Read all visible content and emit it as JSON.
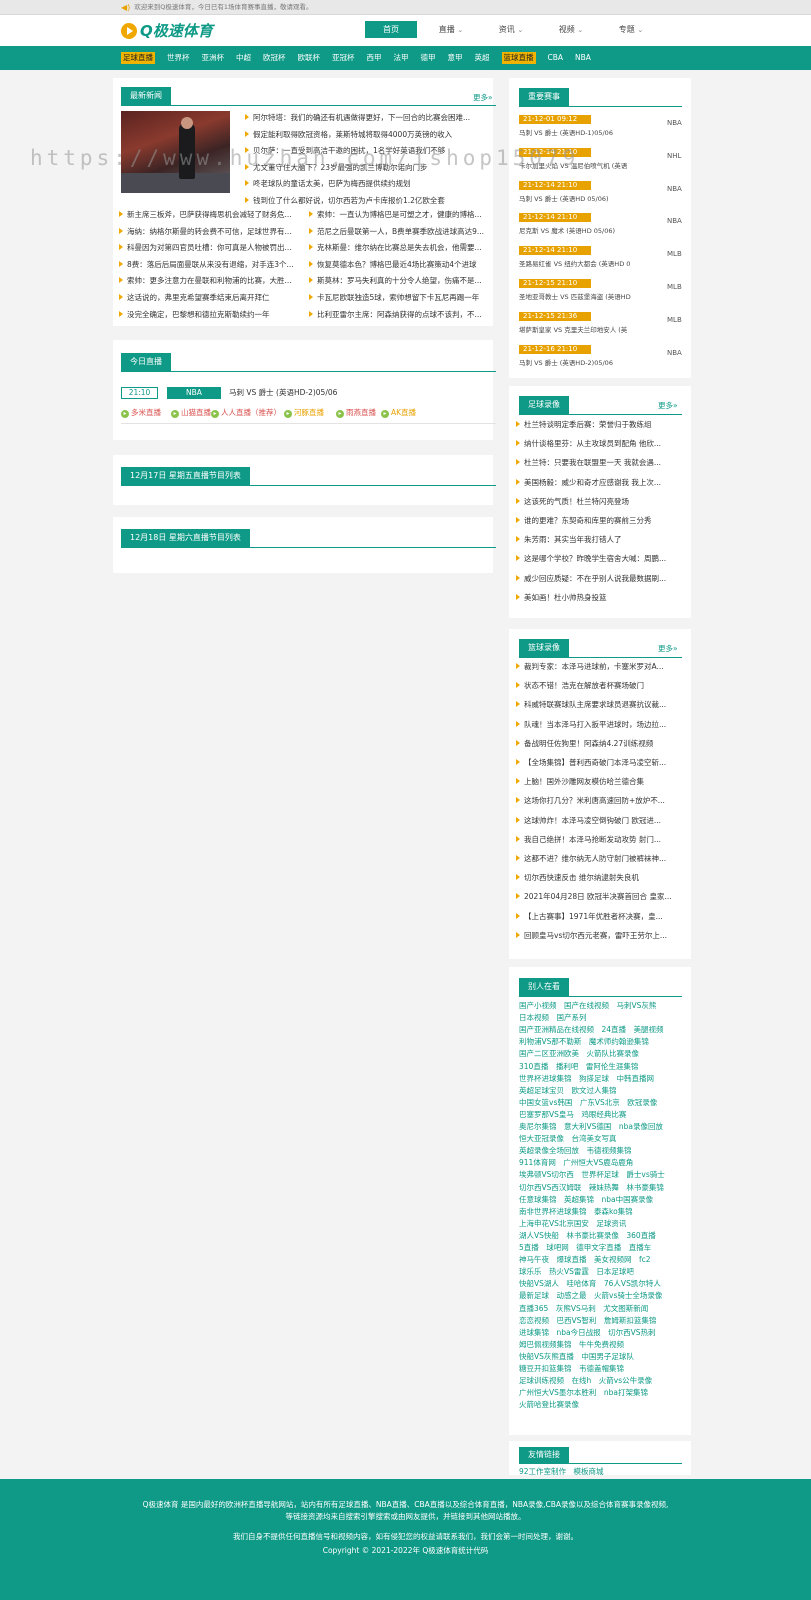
{
  "topbar": {
    "text": "欢迎来到Q极速体育，今日已有1场体育赛事直播，敬请观看。"
  },
  "logo": {
    "text": "Q极速体育"
  },
  "nav": {
    "items": [
      {
        "label": "首页",
        "active": true,
        "caret": ""
      },
      {
        "label": "直播",
        "active": false,
        "caret": "⌄"
      },
      {
        "label": "资讯",
        "active": false,
        "caret": "⌄"
      },
      {
        "label": "视频",
        "active": false,
        "caret": "⌄"
      },
      {
        "label": "专题",
        "active": false,
        "caret": "⌄"
      }
    ]
  },
  "categories": [
    {
      "label": "足球直播",
      "hl": true
    },
    {
      "label": "世界杯",
      "hl": false
    },
    {
      "label": "亚洲杯",
      "hl": false
    },
    {
      "label": "中超",
      "hl": false
    },
    {
      "label": "欧冠杯",
      "hl": false
    },
    {
      "label": "欧联杯",
      "hl": false
    },
    {
      "label": "亚冠杯",
      "hl": false
    },
    {
      "label": "西甲",
      "hl": false
    },
    {
      "label": "法甲",
      "hl": false
    },
    {
      "label": "德甲",
      "hl": false
    },
    {
      "label": "意甲",
      "hl": false
    },
    {
      "label": "英超",
      "hl": false
    },
    {
      "label": "篮球直播",
      "hl": true
    },
    {
      "label": "CBA",
      "hl": false
    },
    {
      "label": "NBA",
      "hl": false
    }
  ],
  "news": {
    "title": "最新新闻",
    "more": "更多»",
    "featured": [
      "阿尔特塔：我们的确还有机遇做得更好，下一回合的比赛会困难...",
      "假定能利取得欧冠资格，莱斯特城将取得4000万英镑的收入",
      "贝尔萨：一直受到高洁干邀的困扰，1名学好英语我们不够",
      "尤文董守住大脑下？23岁最强的凯兰博勒尔诺向门步",
      "咚老球队的童话太美，巴萨为梅西提供续约规划",
      "钱到位了什么都好说，切尔西若为卢卡库报价1.2亿欧全套"
    ],
    "left": [
      "新主席三板斧，巴萨获得梅思机会减轻了财务危...",
      "海纳：纳格尔斯曼的转会费不可信，足球世界有...",
      "科曼因为对第四官员吐槽：你可真是人物被罚出...",
      "8费：落后后局面曼联从来没有退缩，对手连3个...",
      "索帅：更多注意力在曼联和利物浦的比赛，大胜...",
      "这话说的，弗里克希望赛季结束后离开拜仁",
      "没完全确定，巴黎想和德拉克斯勒续约一年"
    ],
    "right": [
      "索帅：一直认为博格巴是可塑之才，健康的博格...",
      "范尼之后曼联第一人，B费单赛季欧战进球高达9...",
      "克林斯曼：维尔纳在比赛总是失去机会，他需要...",
      "恢复莫德本色？博格巴最近4场比赛策动4个进球",
      "斯莫林：罗马失利真的十分令人绝望，伤痛不是...",
      "卡瓦尼欧联独造5球，索帅想留下卡瓦尼再踢一年",
      "比利亚雷尔主席：阿森纳获得的点球不该判，不..."
    ]
  },
  "today": {
    "title": "今日直播",
    "time": "21:10",
    "category": "NBA",
    "match": "马刺 VS 爵士 (英语HD-2)05/06",
    "channels": [
      {
        "label": "多米直播",
        "color": "#d9534f"
      },
      {
        "label": "山猫直播",
        "color": "#d9534f"
      },
      {
        "label": "人人直播（推荐）",
        "color": "#d9534f"
      },
      {
        "label": "河豚直播",
        "color": "#e8a200"
      },
      {
        "label": "雨燕直播",
        "color": "#d9534f"
      },
      {
        "label": "AK直播",
        "color": "#e8a200"
      }
    ]
  },
  "schedule": {
    "day1": "12月17日 星期五直播节目列表",
    "day2": "12月18日 星期六直播节目列表"
  },
  "important": {
    "title": "重要赛事",
    "items": [
      {
        "time": "21-12-01 09:12",
        "name": "马刺 VS 爵士 (英语HD-1)05/06",
        "league": "NBA"
      },
      {
        "time": "21-12-14 21:10",
        "name": "卡尔加里火焰 VS 温尼伯喷气机 (英语",
        "league": "NHL"
      },
      {
        "time": "21-12-14 21:10",
        "name": "马刺 VS 爵士 (英语HD 05/06)",
        "league": "NBA"
      },
      {
        "time": "21-12-14 21:10",
        "name": "尼克斯 VS 魔术 (英语HD 05/06)",
        "league": "NBA"
      },
      {
        "time": "21-12-14 21:10",
        "name": "圣路易红雀 VS 纽约大都会 (英语HD 0",
        "league": "MLB"
      },
      {
        "time": "21-12-15 21:10",
        "name": "圣地亚哥教士 VS 匹兹堡海盗 (英语HD",
        "league": "MLB"
      },
      {
        "time": "21-12-15 21:36",
        "name": "堪萨斯皇家 VS 克里夫兰印地安人 (英",
        "league": "MLB"
      },
      {
        "time": "21-12-16 21:10",
        "name": "马刺 VS 爵士 (英语HD-2)05/06",
        "league": "NBA"
      }
    ]
  },
  "football_video": {
    "title": "足球录像",
    "more": "更多»",
    "items": [
      "杜兰特谈明定季后赛：荣誉归于教练组",
      "纳什谈格里芬：从主攻球员到配角 他欣...",
      "杜兰特：只要我在联盟里一天 我就会遇...",
      "美国杨毅：威少和奇才应感谢我 我上次...",
      "这该死的气质！杜兰特闪亮登场",
      "谁的更难？东契奇和库里的赛前三分秀",
      "朱芳雨：其实当年我打错人了",
      "这是哪个学校？昨晚学生宿舍大喊：周鹏...",
      "威少回应质疑：不在乎别人说我最数据刷...",
      "美如画！杜小帅热身投篮"
    ]
  },
  "basketball_video": {
    "title": "篮球录像",
    "more": "更多»",
    "items": [
      "裁判专家：本泽马进球前，卡塞米罗对A...",
      "状态不错！浩克在解放者杯赛场破门",
      "科威特联赛球队主席要求球员退赛抗议裁...",
      "队魂！当本泽马打入扳平进球时，场边拉...",
      "备战明任佐狗里！阿森纳4.27训练视频",
      "【全场集锦】普利西奇破门本泽马凌空斩...",
      "上脑！国外沙雕网友模仿哈兰德合集",
      "这场你打几分？米利唐高速回防+放炉不...",
      "这球帅炸！本泽马凌空倒钩破门 欧冠进...",
      "我自己绝拼！本泽马抢断发动攻势 射门...",
      "这都不进？维尔纳无人防守射门被裤袜神...",
      "切尔西快速反击 维尔纳逮射失良机",
      "2021年04月28日 欧冠半决赛首回合 皇家...",
      "【上古赛事】1971年优胜者杯决赛，皇...",
      "回顾皇马vs切尔西元老赛，雷吓王劳尔上..."
    ]
  },
  "others": {
    "title": "别人在看",
    "rows": [
      "国产小视频　国产在线视频　马刺VS灰熊",
      "日本视频　国产系列",
      "国产亚洲精品在线视频　24直播　美腿视频",
      "利物浦VS那不勒斯　魔术师约翰逊集锦",
      "国产二区亚洲欧美　火箭队比赛录像",
      "310直播　播利吧　雷阿伦生涯集锦",
      "世界杯进球集锦　狗搽足球　中韩直播网",
      "英超足球宝贝　欧文过人集锦",
      "中国女篮vs韩国　广东VS北京　欧冠录像",
      "巴塞罗那VS皇马　鸡眼经典比赛",
      "奥尼尔集锦　意大利VS德国　nba录像回放",
      "恒大亚冠录像　台湾美女写真",
      "英超录像全场回放　韦德视频集锦",
      "911体育网　广州恒大VS鹿岛鹿角",
      "埃弗顿VS切尔西　世界杯足球　爵士vs骑士",
      "切尔西VS西汉姆联　辣妹热舞　林书豪集锦",
      "任意球集锦　英超集锦　nba中国赛录像",
      "南非世界杯进球集锦　泰森ko集锦",
      "上海申花VS北京国安　足球资讯",
      "湖人VS快船　林书豪比赛录像　360直播",
      "5直播　球吧网　德甲文字直播　直播车",
      "神马午夜　爆球直播　美女视频网　fc2",
      "球乐乐　热火VS雷霆　日本足球吧",
      "快船VS湖人　哇哈体育　76人VS凯尔特人",
      "最新足球　动感之最　火箭vs骑士全场录像",
      "直播365　灰熊VS马刺　尤文图斯新闻",
      "恋恋视频　巴西VS智利　詹姆斯扣篮集锦",
      "进球集锦　nba今日战报　切尔西VS热刺",
      "姆巴佩视频集锦　牛牛免费视频",
      "快船VS灰熊直播　中国男子足球队",
      "糖豆开扣篮集锦　韦德盖帽集锦",
      "足球训练视频　在线h　火箭vs公牛录像",
      "广州恒大VS墨尔本胜利　nba打架集锦",
      "火箭哈登比赛录像"
    ]
  },
  "friends": {
    "title": "友情链接",
    "links": "92工作室制作　模板商城"
  },
  "watermark": "https://www.huzhan.com/ishop15079",
  "footer": {
    "l1": "Q极速体育 是国内最好的欧洲杯直播导航网站，站内有所有足球直播、NBA直播、CBA直播以及综合体育直播，NBA录像,CBA录像以及综合体育赛事录像视频,",
    "l2": "等链接资源均来自搜索引擎搜索或由网友提供，并链接到其他网站播放。",
    "l3": "我们自身不提供任何直播信号和视频内容，如有侵犯您的权益请联系我们，我们会第一时间处理，谢谢。",
    "l4": "Copyright © 2021-2022年 Q极速体育统计代码"
  },
  "colors": {
    "accent": "#0e9a86",
    "highlight": "#f0b400",
    "time": "#e8a200"
  }
}
